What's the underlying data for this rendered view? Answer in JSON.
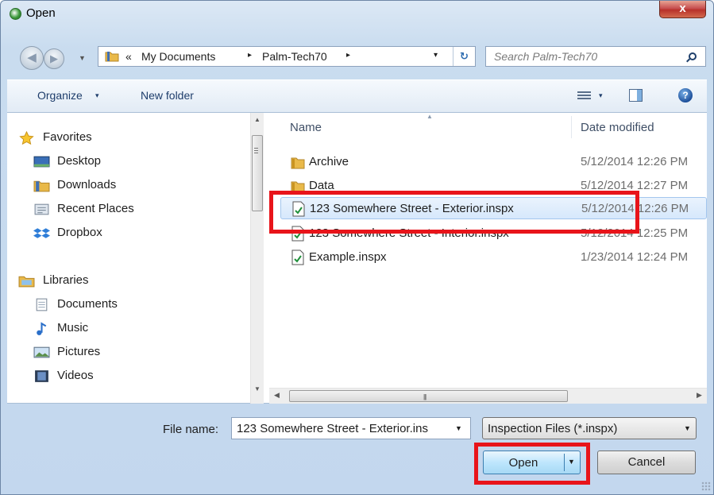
{
  "window": {
    "title": "Open",
    "close_glyph": "x"
  },
  "address": {
    "chevron": "«",
    "crumbs": [
      "My Documents",
      "Palm-Tech70"
    ],
    "separator": "▸",
    "dropdown_glyph": "▾",
    "refresh_glyph": "↻"
  },
  "search": {
    "placeholder": "Search Palm-Tech70"
  },
  "toolbar": {
    "organize_label": "Organize",
    "new_folder_label": "New folder",
    "help_glyph": "?",
    "arrow_glyph": "▾"
  },
  "nav": {
    "favorites": {
      "label": "Favorites",
      "items": [
        {
          "label": "Desktop"
        },
        {
          "label": "Downloads"
        },
        {
          "label": "Recent Places"
        },
        {
          "label": "Dropbox"
        }
      ]
    },
    "libraries": {
      "label": "Libraries",
      "items": [
        {
          "label": "Documents"
        },
        {
          "label": "Music"
        },
        {
          "label": "Pictures"
        },
        {
          "label": "Videos"
        }
      ]
    }
  },
  "files": {
    "columns": {
      "name": "Name",
      "date": "Date modified"
    },
    "rows": [
      {
        "name": "Archive",
        "date": "5/12/2014 12:26 PM",
        "type": "folder"
      },
      {
        "name": "Data",
        "date": "5/12/2014 12:27 PM",
        "type": "folder"
      },
      {
        "name": "123 Somewhere Street - Exterior.inspx",
        "date": "5/12/2014 12:26 PM",
        "type": "inspx",
        "selected": true
      },
      {
        "name": "123 Somewhere Street - Interior.inspx",
        "date": "5/12/2014 12:25 PM",
        "type": "inspx"
      },
      {
        "name": "Example.inspx",
        "date": "1/23/2014 12:24 PM",
        "type": "inspx"
      }
    ]
  },
  "bottom": {
    "file_name_label": "File name:",
    "file_name_value": "123 Somewhere Street - Exterior.ins",
    "filter_value": "Inspection Files (*.inspx)",
    "open_label": "Open",
    "cancel_label": "Cancel"
  },
  "colors": {
    "highlight": "#e8141a",
    "selected_row": "#d6e8fc",
    "folder": "#e9b949"
  }
}
